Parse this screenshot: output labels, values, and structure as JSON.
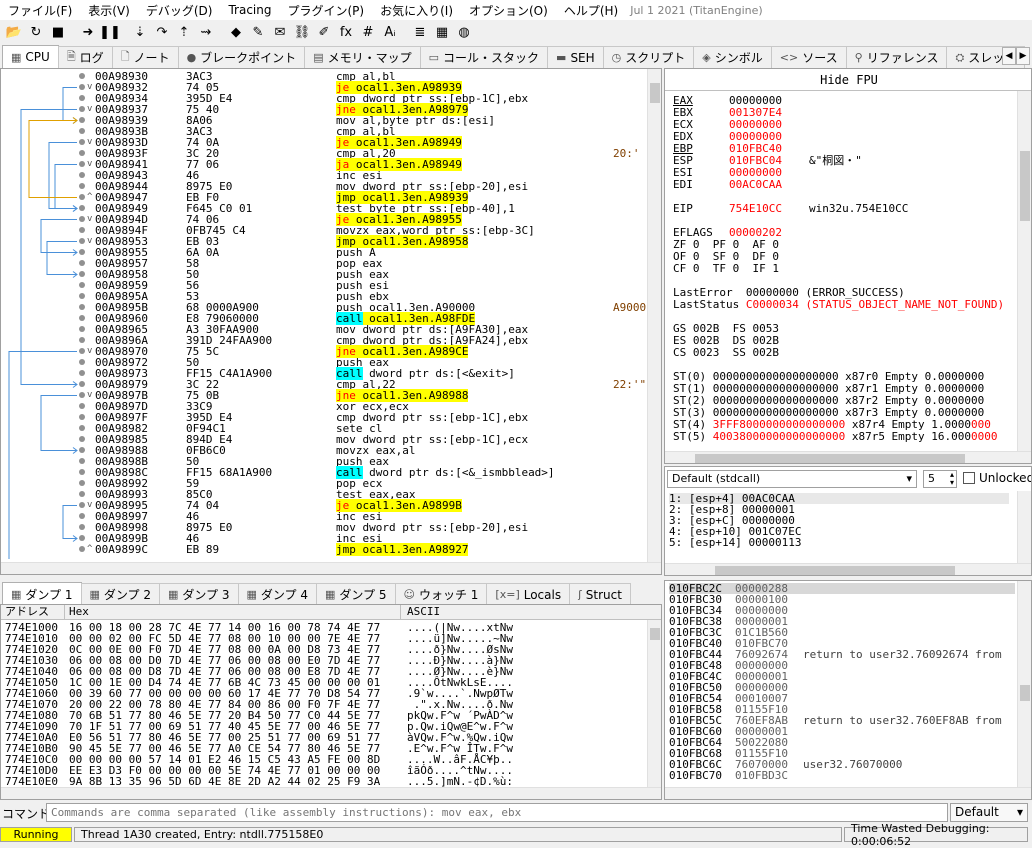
{
  "menu": {
    "items": [
      "ファイル(F)",
      "表示(V)",
      "デバッグ(D)",
      "Tracing",
      "プラグイン(P)",
      "お気に入り(I)",
      "オプション(O)",
      "ヘルプ(H)"
    ],
    "build": "Jul 1 2021 (TitanEngine)"
  },
  "toolbar": {
    "icons": [
      "open-icon",
      "restart-icon",
      "stop-icon",
      "run-icon",
      "pause-icon",
      "step-into-icon",
      "step-over-icon",
      "run-to-user-icon",
      "execute-till-return-icon",
      "breakpoint-icon",
      "comment-icon",
      "label-icon",
      "link-icon",
      "highlight-icon",
      "function-icon",
      "hash-icon",
      "font-icon",
      "list-icon",
      "calculator-icon",
      "globe-icon"
    ],
    "glyphs": [
      "📂",
      "↻",
      "■",
      "➜",
      "❚❚",
      "⇣",
      "↷",
      "⇡",
      "⇝",
      "◆",
      "✎",
      "✉",
      "⛓",
      "✐",
      "fx",
      "#",
      "Aᵢ",
      "≣",
      "▦",
      "◍"
    ]
  },
  "main_tabs": [
    {
      "icon": "cpu-icon",
      "glyph": "▦",
      "label": "CPU",
      "active": true
    },
    {
      "icon": "log-icon",
      "glyph": "🗎",
      "label": "ログ"
    },
    {
      "icon": "notes-icon",
      "glyph": "🗋",
      "label": "ノート"
    },
    {
      "icon": "breakpoint-dot-icon",
      "glyph": "●",
      "label": "ブレークポイント"
    },
    {
      "icon": "memory-map-icon",
      "glyph": "▤",
      "label": "メモリ・マップ"
    },
    {
      "icon": "call-stack-icon",
      "glyph": "▭",
      "label": "コール・スタック"
    },
    {
      "icon": "seh-icon",
      "glyph": "▬",
      "label": "SEH"
    },
    {
      "icon": "script-icon",
      "glyph": "◷",
      "label": "スクリプト"
    },
    {
      "icon": "symbol-icon",
      "glyph": "◈",
      "label": "シンボル"
    },
    {
      "icon": "source-icon",
      "glyph": "<>",
      "label": "ソース"
    },
    {
      "icon": "references-icon",
      "glyph": "⚲",
      "label": "リファレンス"
    },
    {
      "icon": "thread-icon",
      "glyph": "⛭",
      "label": "スレッド"
    }
  ],
  "disasm": [
    {
      "addr": "00A98930",
      "bytes": "3AC3",
      "ins": "cmp al,bl"
    },
    {
      "addr": "00A98932",
      "bytes": "74 05",
      "ins": "je ocal1.3en.A98939",
      "kind": "jcc",
      "mark": "v"
    },
    {
      "addr": "00A98934",
      "bytes": "395D E4",
      "ins": "cmp dword ptr ss:[ebp-1C],ebx"
    },
    {
      "addr": "00A98937",
      "bytes": "75 40",
      "ins": "jne ocal1.3en.A98979",
      "kind": "jcc",
      "mark": "v"
    },
    {
      "addr": "00A98939",
      "bytes": "8A06",
      "ins": "mov al,byte ptr ds:[esi]",
      "mark": ">"
    },
    {
      "addr": "00A9893B",
      "bytes": "3AC3",
      "ins": "cmp al,bl"
    },
    {
      "addr": "00A9893D",
      "bytes": "74 0A",
      "ins": "je ocal1.3en.A98949",
      "kind": "jcc",
      "mark": "v"
    },
    {
      "addr": "00A9893F",
      "bytes": "3C 20",
      "ins": "cmp al,20",
      "com": "20:' '"
    },
    {
      "addr": "00A98941",
      "bytes": "77 06",
      "ins": "ja ocal1.3en.A98949",
      "kind": "jcc",
      "mark": "v"
    },
    {
      "addr": "00A98943",
      "bytes": "46",
      "ins": "inc esi"
    },
    {
      "addr": "00A98944",
      "bytes": "8975 E0",
      "ins": "mov dword ptr ss:[ebp-20],esi"
    },
    {
      "addr": "00A98947",
      "bytes": "EB F0",
      "ins": "jmp ocal1.3en.A98939",
      "kind": "jmp",
      "mark": "^"
    },
    {
      "addr": "00A98949",
      "bytes": "F645 C0 01",
      "ins": "test byte ptr ss:[ebp-40],1",
      "mark": ">"
    },
    {
      "addr": "00A9894D",
      "bytes": "74 06",
      "ins": "je ocal1.3en.A98955",
      "kind": "jcc",
      "mark": "v"
    },
    {
      "addr": "00A9894F",
      "bytes": "0FB745 C4",
      "ins": "movzx eax,word ptr ss:[ebp-3C]"
    },
    {
      "addr": "00A98953",
      "bytes": "EB 03",
      "ins": "jmp ocal1.3en.A98958",
      "kind": "jmp",
      "mark": "v"
    },
    {
      "addr": "00A98955",
      "bytes": "6A 0A",
      "ins": "push A",
      "mark": ">"
    },
    {
      "addr": "00A98957",
      "bytes": "58",
      "ins": "pop eax"
    },
    {
      "addr": "00A98958",
      "bytes": "50",
      "ins": "push eax",
      "mark": ">"
    },
    {
      "addr": "00A98959",
      "bytes": "56",
      "ins": "push esi"
    },
    {
      "addr": "00A9895A",
      "bytes": "53",
      "ins": "push ebx"
    },
    {
      "addr": "00A9895B",
      "bytes": "68 0000A900",
      "ins": "push ocal1.3en.A90000",
      "com": "A9000"
    },
    {
      "addr": "00A98960",
      "bytes": "E8 79060000",
      "ins": "call ocal1.3en.A98FDE",
      "kind": "call"
    },
    {
      "addr": "00A98965",
      "bytes": "A3 30FAA900",
      "ins": "mov dword ptr ds:[A9FA30],eax"
    },
    {
      "addr": "00A9896A",
      "bytes": "391D 24FAA900",
      "ins": "cmp dword ptr ds:[A9FA24],ebx"
    },
    {
      "addr": "00A98970",
      "bytes": "75 5C",
      "ins": "jne ocal1.3en.A989CE",
      "kind": "jcc",
      "mark": "v"
    },
    {
      "addr": "00A98972",
      "bytes": "50",
      "ins": "push eax"
    },
    {
      "addr": "00A98973",
      "bytes": "FF15 C4A1A900",
      "ins": "call dword ptr ds:[<&exit>]",
      "kind": "call"
    },
    {
      "addr": "00A98979",
      "bytes": "3C 22",
      "ins": "cmp al,22",
      "com": "22:'\"'",
      "mark": ">"
    },
    {
      "addr": "00A9897B",
      "bytes": "75 0B",
      "ins": "jne ocal1.3en.A98988",
      "kind": "jcc",
      "mark": "v"
    },
    {
      "addr": "00A9897D",
      "bytes": "33C9",
      "ins": "xor ecx,ecx"
    },
    {
      "addr": "00A9897F",
      "bytes": "395D E4",
      "ins": "cmp dword ptr ss:[ebp-1C],ebx"
    },
    {
      "addr": "00A98982",
      "bytes": "0F94C1",
      "ins": "sete cl"
    },
    {
      "addr": "00A98985",
      "bytes": "894D E4",
      "ins": "mov dword ptr ss:[ebp-1C],ecx"
    },
    {
      "addr": "00A98988",
      "bytes": "0FB6C0",
      "ins": "movzx eax,al",
      "mark": ">"
    },
    {
      "addr": "00A9898B",
      "bytes": "50",
      "ins": "push eax"
    },
    {
      "addr": "00A9898C",
      "bytes": "FF15 68A1A900",
      "ins": "call dword ptr ds:[<&_ismbblead>]",
      "kind": "call"
    },
    {
      "addr": "00A98992",
      "bytes": "59",
      "ins": "pop ecx"
    },
    {
      "addr": "00A98993",
      "bytes": "85C0",
      "ins": "test eax,eax"
    },
    {
      "addr": "00A98995",
      "bytes": "74 04",
      "ins": "je ocal1.3en.A9899B",
      "kind": "jcc",
      "mark": "v"
    },
    {
      "addr": "00A98997",
      "bytes": "46",
      "ins": "inc esi"
    },
    {
      "addr": "00A98998",
      "bytes": "8975 E0",
      "ins": "mov dword ptr ss:[ebp-20],esi"
    },
    {
      "addr": "00A9899B",
      "bytes": "46",
      "ins": "inc esi",
      "mark": ">"
    },
    {
      "addr": "00A9899C",
      "bytes": "EB 89",
      "ins": "jmp ocal1.3en.A98927",
      "kind": "jmp",
      "mark": "^"
    }
  ],
  "regs": {
    "hide_fpu": "Hide FPU",
    "lines": [
      {
        "n": "EAX",
        "v": "00000000",
        "c": "",
        "u": true,
        "red": false
      },
      {
        "n": "EBX",
        "v": "001307E4",
        "c": "",
        "red": true
      },
      {
        "n": "ECX",
        "v": "00000000",
        "c": "",
        "red": true
      },
      {
        "n": "EDX",
        "v": "00000000",
        "c": "",
        "red": true
      },
      {
        "n": "EBP",
        "v": "010FBC40",
        "c": "",
        "red": true,
        "u": true
      },
      {
        "n": "ESP",
        "v": "010FBC04",
        "c": "&\"桐図・\"",
        "red": true
      },
      {
        "n": "ESI",
        "v": "00000000",
        "c": "",
        "red": true
      },
      {
        "n": "EDI",
        "v": "00AC0CAA",
        "c": "",
        "red": true
      },
      {
        "n": "",
        "v": "",
        "c": ""
      },
      {
        "n": "EIP",
        "v": "754E10CC",
        "c": "win32u.754E10CC",
        "red": true
      },
      {
        "n": "",
        "v": "",
        "c": ""
      },
      {
        "n": "EFLAGS",
        "v": "00000202",
        "c": "",
        "red": true
      },
      {
        "raw": "ZF 0  PF 0  AF 0"
      },
      {
        "raw": "OF 0  SF 0  DF 0"
      },
      {
        "raw": "CF 0  TF 0  IF 1"
      },
      {
        "raw": ""
      },
      {
        "raw": "LastError  00000000 (ERROR_SUCCESS)"
      },
      {
        "raw": "LastStatus C0000034 (STATUS_OBJECT_NAME_NOT_FOUND)",
        "red": true
      },
      {
        "raw": ""
      },
      {
        "raw": "GS 002B  FS 0053"
      },
      {
        "raw": "ES 002B  DS 002B"
      },
      {
        "raw": "CS 0023  SS 002B"
      },
      {
        "raw": ""
      },
      {
        "raw": "ST(0) 0000000000000000000 x87r0 Empty 0.0000000"
      },
      {
        "raw": "ST(1) 0000000000000000000 x87r1 Empty 0.0000000"
      },
      {
        "raw": "ST(2) 0000000000000000000 x87r2 Empty 0.0000000"
      },
      {
        "raw": "ST(3) 0000000000000000000 x87r3 Empty 0.0000000"
      },
      {
        "raw": "ST(4) 3FFF8000000000000000 x87r4 Empty 1.0000000",
        "red": true
      },
      {
        "raw": "ST(5) 40038000000000000000 x87r5 Empty 16.0000000",
        "red": true
      }
    ]
  },
  "callconv": {
    "selected": "Default (stdcall)",
    "count": "5",
    "unlocked_label": "Unlocked",
    "args": [
      "1: [esp+4] 00AC0CAA",
      "2: [esp+8] 00000001",
      "3: [esp+C] 00000000",
      "4: [esp+10] 001C07EC",
      "5: [esp+14] 00000113"
    ]
  },
  "dump_tabs": [
    {
      "icon": "dump-icon",
      "label": "ダンプ 1",
      "active": true
    },
    {
      "icon": "dump-icon",
      "label": "ダンプ 2"
    },
    {
      "icon": "dump-icon",
      "label": "ダンプ 3"
    },
    {
      "icon": "dump-icon",
      "label": "ダンプ 4"
    },
    {
      "icon": "dump-icon",
      "label": "ダンプ 5"
    },
    {
      "icon": "watch-icon",
      "label": "ウォッチ 1"
    },
    {
      "icon": "locals-icon",
      "label": "Locals"
    },
    {
      "icon": "struct-icon",
      "label": "Struct"
    }
  ],
  "dump": {
    "headers": [
      "アドレス",
      "Hex",
      "ASCII"
    ],
    "rows": [
      {
        "a": "774E1000",
        "h": "16 00 18 00 28 7C 4E 77 14 00 16 00 78 74 4E 77",
        "s": "....(|Nw....xtNw"
      },
      {
        "a": "774E1010",
        "h": "00 00 02 00 FC 5D 4E 77 08 00 10 00 00 7E 4E 77",
        "s": "....ü]Nw.....~Nw"
      },
      {
        "a": "774E1020",
        "h": "0C 00 0E 00 F0 7D 4E 77 08 00 0A 00 D8 73 4E 77",
        "s": "....ð}Nw....ØsNw"
      },
      {
        "a": "774E1030",
        "h": "06 00 08 00 D0 7D 4E 77 06 00 08 00 E0 7D 4E 77",
        "s": "....Ð}Nw....à}Nw"
      },
      {
        "a": "774E1040",
        "h": "06 00 08 00 D8 7D 4E 77 06 00 08 00 E8 7D 4E 77",
        "s": "....Ø}Nw....è}Nw"
      },
      {
        "a": "774E1050",
        "h": "1C 00 1E 00 D4 74 4E 77 6B 4C 73 45 00 00 00 01",
        "s": "....ÔtNwkLsE...."
      },
      {
        "a": "774E1060",
        "h": "00 39 60 77 00 00 00 00 60 17 4E 77 70 D8 54 77",
        "s": ".9`w....`.NwpØTw"
      },
      {
        "a": "774E1070",
        "h": "20 00 22 00 78 80 4E 77 84 00 86 00 F0 7F 4E 77",
        "s": " .\".x.Nw....ð.Nw"
      },
      {
        "a": "774E1080",
        "h": "70 6B 51 77 80 46 5E 77 20 B4 50 77 C0 44 5E 77",
        "s": "pkQw.F^w ´PwÀD^w"
      },
      {
        "a": "774E1090",
        "h": "70 1F 51 77 00 69 51 77 40 45 5E 77 00 46 5E 77",
        "s": "p.Qw.iQw@E^w.F^w"
      },
      {
        "a": "774E10A0",
        "h": "E0 56 51 77 80 46 5E 77 00 25 51 77 00 69 51 77",
        "s": "àVQw.F^w.%Qw.iQw"
      },
      {
        "a": "774E10B0",
        "h": "90 45 5E 77 00 46 5E 77 A0 CE 54 77 80 46 5E 77",
        "s": ".E^w.F^w ÎTw.F^w"
      },
      {
        "a": "774E10C0",
        "h": "00 00 00 00 57 14 01 E2 46 15 C5 43 A5 FE 00 8D",
        "s": "....W..âF.ÅC¥þ.."
      },
      {
        "a": "774E10D0",
        "h": "EE E3 D3 F0 00 00 00 00 5E 74 4E 77 01 00 00 00",
        "s": "îãÓð....^tNw...."
      },
      {
        "a": "774E10E0",
        "h": "9A 8B 13 35 96 5D 6D 4E 8E 2D A2 44 02 25 F9 3A",
        "s": "...5.]mN.-¢D.%ù:"
      }
    ]
  },
  "stack": {
    "rows": [
      {
        "a": "010FBC2C",
        "v": "00000288",
        "c": "",
        "hl": true
      },
      {
        "a": "010FBC30",
        "v": "00000100",
        "c": ""
      },
      {
        "a": "010FBC34",
        "v": "00000000",
        "c": ""
      },
      {
        "a": "010FBC38",
        "v": "00000001",
        "c": ""
      },
      {
        "a": "010FBC3C",
        "v": "01C1B560",
        "c": ""
      },
      {
        "a": "010FBC40",
        "v": "010FBC70",
        "c": ""
      },
      {
        "a": "010FBC44",
        "v": "76092674",
        "c": "return to user32.76092674 from"
      },
      {
        "a": "010FBC48",
        "v": "00000000",
        "c": ""
      },
      {
        "a": "010FBC4C",
        "v": "00000001",
        "c": ""
      },
      {
        "a": "010FBC50",
        "v": "00000000",
        "c": ""
      },
      {
        "a": "010FBC54",
        "v": "00010007",
        "c": ""
      },
      {
        "a": "010FBC58",
        "v": "01155F10",
        "c": ""
      },
      {
        "a": "010FBC5C",
        "v": "760EF8AB",
        "c": "return to user32.760EF8AB from"
      },
      {
        "a": "010FBC60",
        "v": "00000001",
        "c": ""
      },
      {
        "a": "010FBC64",
        "v": "50022080",
        "c": ""
      },
      {
        "a": "010FBC68",
        "v": "01155F10",
        "c": ""
      },
      {
        "a": "010FBC6C",
        "v": "76070000",
        "c": "user32.76070000"
      },
      {
        "a": "010FBC70",
        "v": "010FBD3C",
        "c": ""
      }
    ]
  },
  "command": {
    "label": "コマンド:",
    "placeholder": "Commands are comma separated (like assembly instructions): mov eax, ebx",
    "mode": "Default"
  },
  "status": {
    "state": "Running",
    "message": "Thread 1A30 created, Entry: ntdll.775158E0",
    "time": "Time Wasted Debugging: 0:00:06:52"
  },
  "colors": {
    "jcc_bg": "#ffff00",
    "call_bg": "#00ffff",
    "changed": "#ff0000",
    "running": "#ffff00"
  }
}
